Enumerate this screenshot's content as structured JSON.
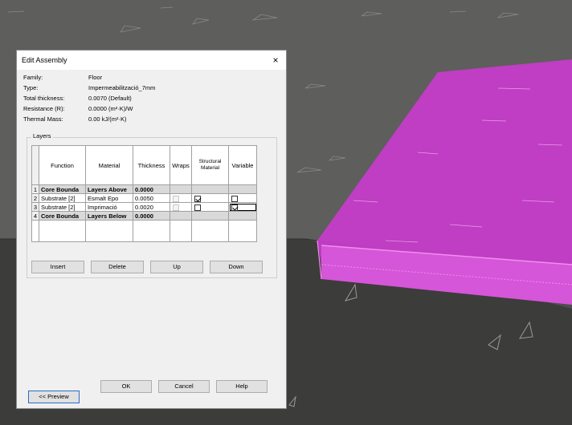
{
  "dialog": {
    "title": "Edit Assembly",
    "close_glyph": "×",
    "properties": [
      {
        "label": "Family:",
        "value": "Floor"
      },
      {
        "label": "Type:",
        "value": "Impermeabilització_7mm"
      },
      {
        "label": "Total thickness:",
        "value": "0.0070 (Default)"
      },
      {
        "label": "Resistance (R):",
        "value": "0.0000 (m²·K)/W"
      },
      {
        "label": "Thermal Mass:",
        "value": "0.00 kJ/(m²·K)"
      }
    ],
    "layers_legend": "Layers",
    "table": {
      "headers": {
        "function": "Function",
        "material": "Material",
        "thickness": "Thickness",
        "wraps": "Wraps",
        "structural": "Structural Material",
        "variable": "Variable"
      },
      "rows": [
        {
          "num": "1",
          "function": "Core Bounda",
          "material": "Layers Above",
          "thickness": "0.0000"
        },
        {
          "num": "2",
          "function": "Substrate [2]",
          "material": "Esmalt Epo",
          "thickness": "0.0050",
          "wraps": false,
          "structural": true,
          "variable": false
        },
        {
          "num": "3",
          "function": "Substrate [2]",
          "material": "Imprimació",
          "thickness": "0.0020",
          "wraps": false,
          "structural": false,
          "variable": true
        },
        {
          "num": "4",
          "function": "Core Bounda",
          "material": "Layers Below",
          "thickness": "0.0000"
        }
      ]
    },
    "buttons": {
      "insert": "Insert",
      "delete": "Delete",
      "up": "Up",
      "down": "Down",
      "preview": "<< Preview",
      "ok": "OK",
      "cancel": "Cancel",
      "help": "Help"
    }
  },
  "colors": {
    "slab_fill": "#cc33cc",
    "slab_edge": "#e04fe0",
    "viewport_bg": "#5a5a5a"
  }
}
